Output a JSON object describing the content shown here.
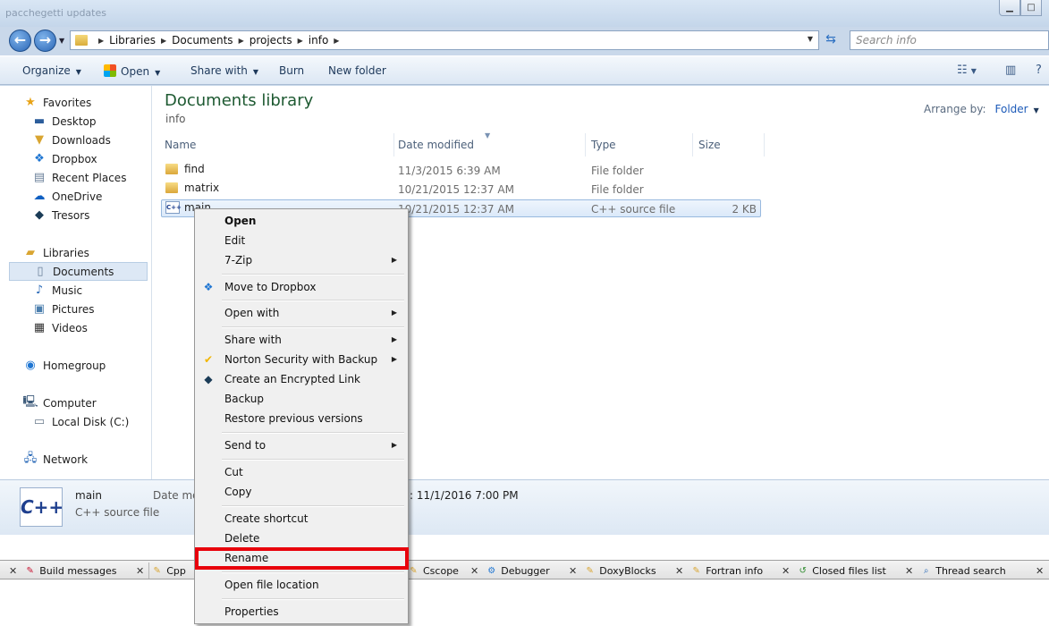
{
  "window": {
    "ghost_title": "pacchegetti updates",
    "controls": [
      "minimize",
      "maximize"
    ]
  },
  "address": {
    "crumbs": [
      "Libraries",
      "Documents",
      "projects",
      "info"
    ],
    "search_placeholder": "Search info"
  },
  "toolbar": {
    "organize": "Organize",
    "open": "Open",
    "share_with": "Share with",
    "burn": "Burn",
    "new_folder": "New folder"
  },
  "nav": {
    "favorites": "Favorites",
    "desktop": "Desktop",
    "downloads": "Downloads",
    "dropbox": "Dropbox",
    "recent_places": "Recent Places",
    "onedrive": "OneDrive",
    "tresors": "Tresors",
    "libraries": "Libraries",
    "documents": "Documents",
    "music": "Music",
    "pictures": "Pictures",
    "videos": "Videos",
    "homegroup": "Homegroup",
    "computer": "Computer",
    "local_disk": "Local Disk (C:)",
    "network": "Network"
  },
  "content": {
    "title": "Documents library",
    "subtitle": "info",
    "arrange_label": "Arrange by:",
    "arrange_value": "Folder",
    "columns": [
      "Name",
      "Date modified",
      "Type",
      "Size"
    ],
    "files": [
      {
        "name": "find",
        "date": "11/3/2015 6:39 AM",
        "type": "File folder",
        "size": ""
      },
      {
        "name": "matrix",
        "date": "10/21/2015 12:37 AM",
        "type": "File folder",
        "size": ""
      },
      {
        "name": "main",
        "date": "10/21/2015 12:37 AM",
        "type": "C++ source file",
        "size": "2 KB"
      }
    ]
  },
  "details": {
    "name": "main",
    "type": "C++ source file",
    "date_label": "Date mo",
    "date_value": ": 11/1/2016 7:00 PM"
  },
  "context_menu": {
    "open": "Open",
    "edit": "Edit",
    "zip": "7-Zip",
    "move_dropbox": "Move to Dropbox",
    "open_with": "Open with",
    "share_with": "Share with",
    "norton": "Norton Security with Backup",
    "encrypted_link": "Create an Encrypted Link",
    "backup": "Backup",
    "restore": "Restore previous versions",
    "send_to": "Send to",
    "cut": "Cut",
    "copy": "Copy",
    "create_shortcut": "Create shortcut",
    "delete": "Delete",
    "rename": "Rename",
    "open_location": "Open file location",
    "properties": "Properties"
  },
  "ide_tabs": {
    "build_messages": "Build messages",
    "cppcheck": "Cpp",
    "cscope": "Cscope",
    "debugger": "Debugger",
    "doxyblocks": "DoxyBlocks",
    "fortran_info": "Fortran info",
    "closed_files": "Closed files list",
    "thread_search": "Thread search"
  },
  "colors": {
    "highlight": "#e8000b",
    "library_title": "#1e5a32",
    "link_blue": "#1c5ab8"
  }
}
